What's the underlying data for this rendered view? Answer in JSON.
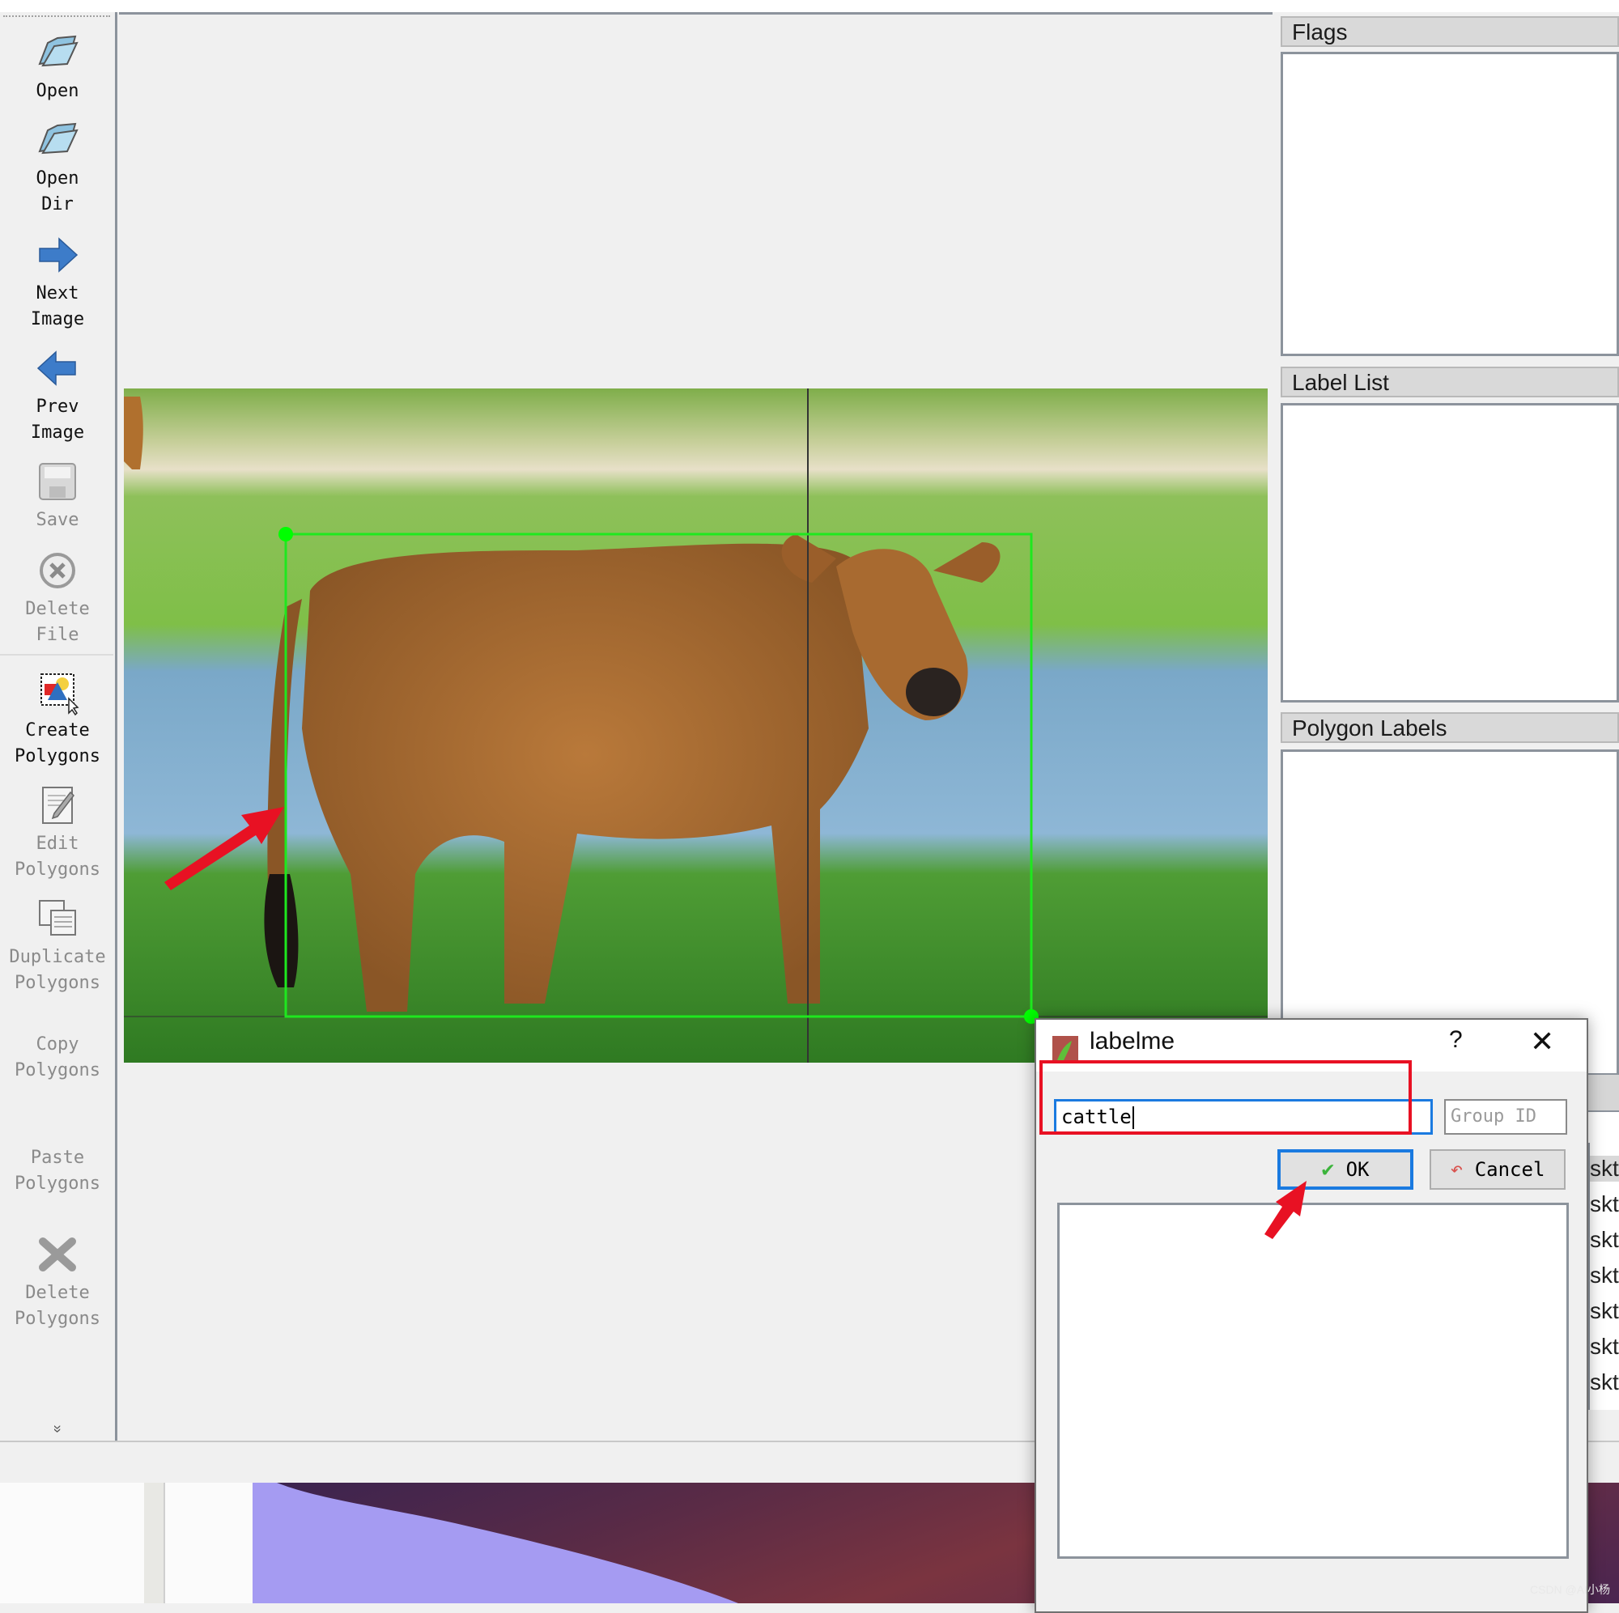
{
  "toolbar": {
    "items": [
      {
        "label": "Open",
        "icon": "folder-open-icon",
        "enabled": true
      },
      {
        "label": "Open\nDir",
        "icon": "folder-open-icon",
        "enabled": true
      },
      {
        "label": "Next\nImage",
        "icon": "arrow-right-icon",
        "enabled": true
      },
      {
        "label": "Prev\nImage",
        "icon": "arrow-left-icon",
        "enabled": true
      },
      {
        "label": "Save",
        "icon": "save-icon",
        "enabled": false
      },
      {
        "label": "Delete\nFile",
        "icon": "delete-circle-icon",
        "enabled": false
      },
      {
        "label": "Create\nPolygons",
        "icon": "create-polygon-icon",
        "enabled": true
      },
      {
        "label": "Edit\nPolygons",
        "icon": "edit-icon",
        "enabled": false
      },
      {
        "label": "Duplicate\nPolygons",
        "icon": "duplicate-icon",
        "enabled": false
      },
      {
        "label": "Copy\nPolygons",
        "icon": "none",
        "enabled": false
      },
      {
        "label": "Paste\nPolygons",
        "icon": "none",
        "enabled": false
      },
      {
        "label": "Delete\nPolygons",
        "icon": "delete-x-icon",
        "enabled": false
      }
    ],
    "more_glyph": "»"
  },
  "docks": {
    "flags": {
      "title": "Flags",
      "items": []
    },
    "label_list": {
      "title": "Label List",
      "items": []
    },
    "polygon_labels": {
      "title": "Polygon Labels",
      "items": []
    }
  },
  "file_list_peek": [
    "skt",
    "skt",
    "skt",
    "skt",
    "skt",
    "skt",
    "skt"
  ],
  "canvas": {
    "shape_type": "rectangle",
    "shape_color": "#00ff00",
    "annotation_arrow_color": "#e81123"
  },
  "dialog": {
    "title": "labelme",
    "help_glyph": "?",
    "close_glyph": "✕",
    "label_value": "cattle",
    "group_id_placeholder": "Group ID",
    "ok_label": "OK",
    "cancel_label": "Cancel",
    "label_suggestions": []
  },
  "colors": {
    "focus_blue": "#1a7ae0",
    "highlight_red": "#e81123"
  },
  "watermark": "CSDN @AI小杨"
}
